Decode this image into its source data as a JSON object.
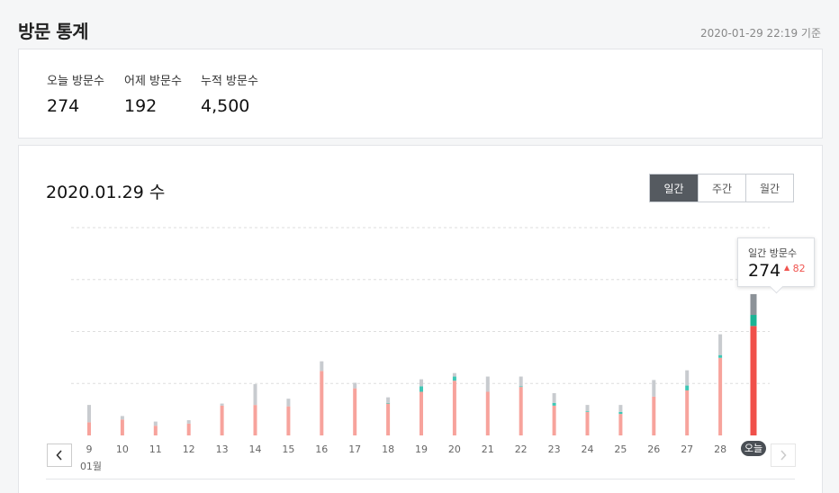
{
  "page": {
    "title": "방문 통계",
    "timestamp": "2020-01-29 22:19 기준"
  },
  "summary": {
    "today": {
      "label": "오늘 방문수",
      "value": "274"
    },
    "yesterday": {
      "label": "어제 방문수",
      "value": "192"
    },
    "total": {
      "label": "누적 방문수",
      "value": "4,500"
    }
  },
  "chart_header": {
    "date": "2020.01.29 수"
  },
  "period_tabs": [
    {
      "label": "일간",
      "active": true
    },
    {
      "label": "주간",
      "active": false
    },
    {
      "label": "월간",
      "active": false
    }
  ],
  "tooltip": {
    "label": "일간 방문수",
    "value": "274",
    "delta": "82"
  },
  "colors": {
    "bar": "#f7a39c",
    "today_bar": "#f0504a",
    "gray": "#c8cbcf",
    "today_gray": "#8c9298",
    "teal": "#3ec7b5",
    "today_teal": "#1bb394"
  },
  "chart_data": {
    "type": "bar",
    "stacked": true,
    "categories": [
      "9",
      "10",
      "11",
      "12",
      "13",
      "14",
      "15",
      "16",
      "17",
      "18",
      "19",
      "20",
      "21",
      "22",
      "23",
      "24",
      "25",
      "26",
      "27",
      "28",
      "오늘"
    ],
    "month_label": "01월",
    "today_index": 20,
    "ylim": [
      0,
      300
    ],
    "series": [
      {
        "values": [
          19,
          23,
          14,
          17,
          43,
          44,
          42,
          93,
          68,
          46,
          63,
          79,
          63,
          70,
          43,
          34,
          31,
          56,
          65,
          112,
          158
        ]
      },
      {
        "values": [
          0,
          0,
          0,
          0,
          0,
          0,
          0,
          0,
          0,
          1,
          8,
          6,
          0,
          1,
          4,
          1,
          3,
          0,
          7,
          4,
          16
        ]
      },
      {
        "values": [
          25,
          5,
          6,
          5,
          3,
          30,
          11,
          14,
          8,
          8,
          10,
          5,
          22,
          14,
          14,
          9,
          10,
          24,
          22,
          30,
          30
        ]
      }
    ]
  }
}
